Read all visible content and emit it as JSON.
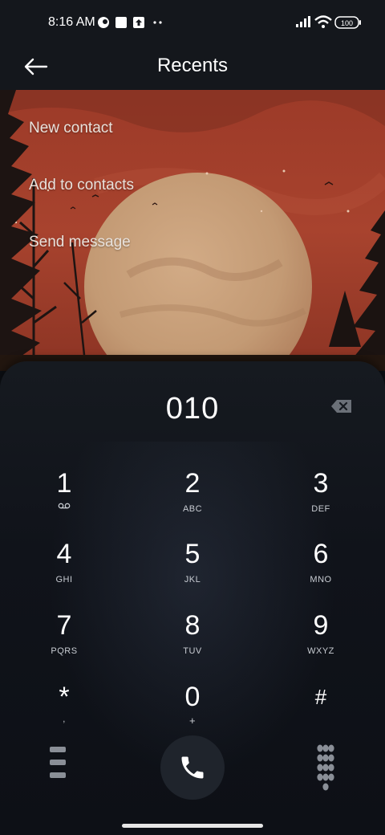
{
  "status_bar": {
    "time": "8:16 AM",
    "battery": "100",
    "icons": [
      "notification-icon",
      "square-icon",
      "upload-icon",
      "more-dots-icon",
      "signal-icon",
      "wifi-icon",
      "battery-icon"
    ]
  },
  "header": {
    "title": "Recents",
    "back_icon": "arrow-left-icon"
  },
  "menu": {
    "items": [
      {
        "label": "New contact"
      },
      {
        "label": "Add to contacts"
      },
      {
        "label": "Send message"
      }
    ]
  },
  "dialer": {
    "number": "010",
    "backspace_icon": "backspace-icon",
    "keys": [
      {
        "digit": "1",
        "letters": "",
        "extra": "voicemail-icon"
      },
      {
        "digit": "2",
        "letters": "ABC"
      },
      {
        "digit": "3",
        "letters": "DEF"
      },
      {
        "digit": "4",
        "letters": "GHI"
      },
      {
        "digit": "5",
        "letters": "JKL"
      },
      {
        "digit": "6",
        "letters": "MNO"
      },
      {
        "digit": "7",
        "letters": "PQRS"
      },
      {
        "digit": "8",
        "letters": "TUV"
      },
      {
        "digit": "9",
        "letters": "WXYZ"
      },
      {
        "digit": "*",
        "letters": ","
      },
      {
        "digit": "0",
        "letters": "+"
      },
      {
        "digit": "#",
        "letters": ""
      }
    ],
    "call_icon": "phone-icon",
    "left_icon": "menu-icon",
    "right_icon": "keypad-icon"
  },
  "colors": {
    "wallpaper_sky": "#a3402c",
    "moon": "#c9a27b",
    "panel": "#14171c"
  }
}
